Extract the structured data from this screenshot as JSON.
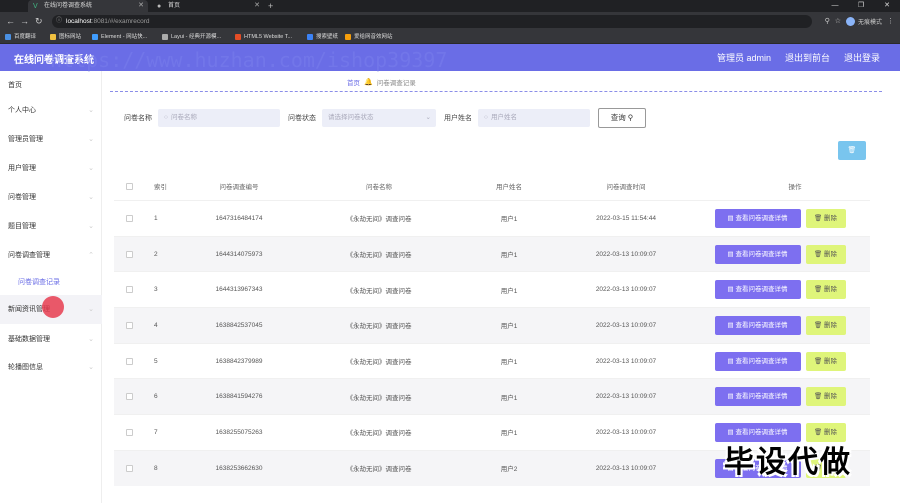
{
  "browser": {
    "tabs": [
      {
        "title": "在线问卷调查系统",
        "active": true
      },
      {
        "title": "首页",
        "active": false
      }
    ],
    "url_host": "localhost",
    "url_path": ":8081/#/examrecord",
    "profile_label": "无痕模式",
    "bookmarks": [
      "百度翻译",
      "图标网站",
      "Element - 网站快...",
      "Layui - 经典开源模...",
      "HTML5 Website T...",
      "搜索壁纸",
      "爱给网音效网站"
    ]
  },
  "header": {
    "title": "在线问卷调查系统",
    "admin_label": "管理员 admin",
    "back_label": "退出到前台",
    "logout_label": "退出登录"
  },
  "sidebar": {
    "items": [
      {
        "label": "首页",
        "sub": false,
        "chevron": false
      },
      {
        "label": "个人中心",
        "sub": false,
        "chevron": true
      },
      {
        "label": "管理员管理",
        "sub": false,
        "chevron": true
      },
      {
        "label": "用户管理",
        "sub": false,
        "chevron": true
      },
      {
        "label": "问卷管理",
        "sub": false,
        "chevron": true
      },
      {
        "label": "题目管理",
        "sub": false,
        "chevron": true
      },
      {
        "label": "问卷调查管理",
        "sub": false,
        "chevron": true
      },
      {
        "label": "问卷调查记录",
        "sub": true,
        "chevron": false
      },
      {
        "label": "新闻资讯管理",
        "sub": false,
        "chevron": true
      },
      {
        "label": "基础数据管理",
        "sub": false,
        "chevron": true
      },
      {
        "label": "轮播图信息",
        "sub": false,
        "chevron": true
      }
    ]
  },
  "breadcrumb": {
    "home": "首页",
    "current": "问卷调查记录"
  },
  "search": {
    "name_label": "问卷名称",
    "name_placeholder": "问卷名称",
    "status_label": "问卷状态",
    "status_placeholder": "请选择问卷状态",
    "user_label": "用户姓名",
    "user_placeholder": "用户姓名",
    "query_label": "查询"
  },
  "table": {
    "headers": {
      "index": "索引",
      "code": "问卷调查编号",
      "name": "问卷名称",
      "user": "用户姓名",
      "time": "问卷调查时间",
      "ops": "操作"
    },
    "detail_label": "查看问卷调查详情",
    "delete_label": "删除",
    "rows": [
      {
        "index": "1",
        "code": "1647316484174",
        "name": "《永劫无间》调查问卷",
        "user": "用户1",
        "time": "2022-03-15 11:54:44"
      },
      {
        "index": "2",
        "code": "1644314075973",
        "name": "《永劫无间》调查问卷",
        "user": "用户1",
        "time": "2022-03-13 10:09:07"
      },
      {
        "index": "3",
        "code": "1644313967343",
        "name": "《永劫无间》调查问卷",
        "user": "用户1",
        "time": "2022-03-13 10:09:07"
      },
      {
        "index": "4",
        "code": "1638842537045",
        "name": "《永劫无间》调查问卷",
        "user": "用户1",
        "time": "2022-03-13 10:09:07"
      },
      {
        "index": "5",
        "code": "1638842379989",
        "name": "《永劫无间》调查问卷",
        "user": "用户1",
        "time": "2022-03-13 10:09:07"
      },
      {
        "index": "6",
        "code": "1638841594276",
        "name": "《永劫无间》调查问卷",
        "user": "用户1",
        "time": "2022-03-13 10:09:07"
      },
      {
        "index": "7",
        "code": "1638255075263",
        "name": "《永劫无间》调查问卷",
        "user": "用户1",
        "time": "2022-03-13 10:09:07"
      },
      {
        "index": "8",
        "code": "1638253662630",
        "name": "《永劫无间》调查问卷",
        "user": "用户2",
        "time": "2022-03-13 10:09:07"
      }
    ]
  },
  "overlays": {
    "watermark": "https://www.huzhan.com/ishop39397",
    "corner_text": "毕设代做"
  },
  "colors": {
    "header": "#6a6de6",
    "detail_button": "#7d6ff0",
    "delete_button": "#dff57a",
    "icon_button": "#79c5ee"
  }
}
